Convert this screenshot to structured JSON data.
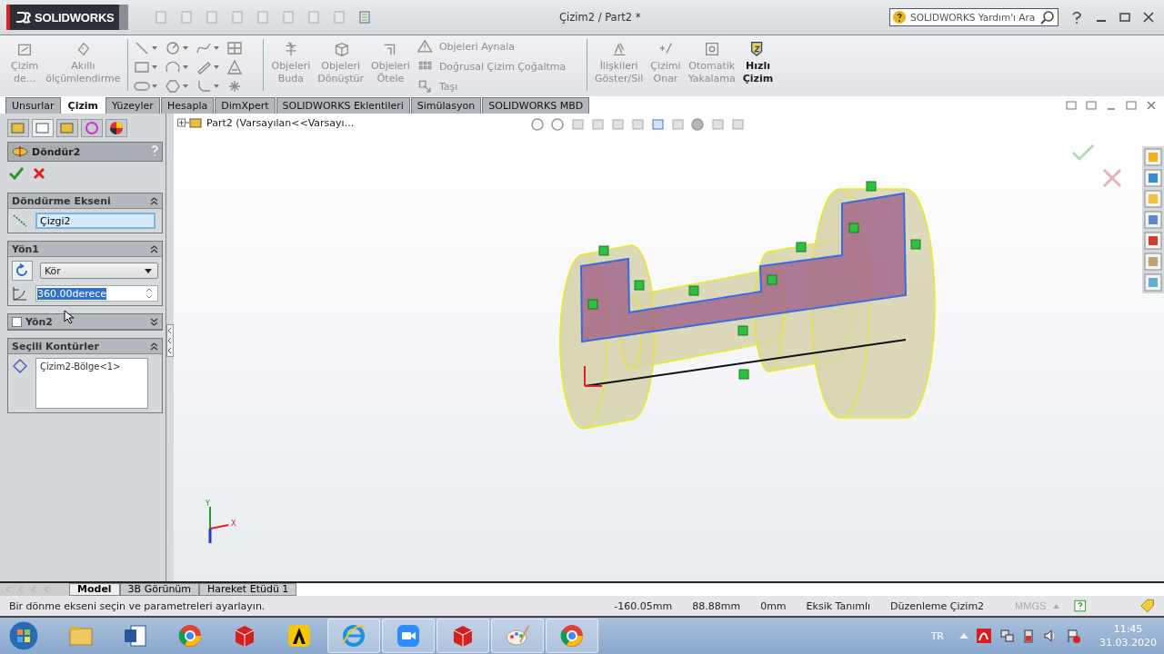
{
  "app": {
    "logo_text": "SOLIDWORKS",
    "title": "Çizim2 / Part2 *",
    "search_placeholder": "SOLIDWORKS Yardım'ı Ara"
  },
  "ribbon": {
    "left": [
      {
        "label": "Çizim de...",
        "kind": "sketch",
        "disabled": true
      },
      {
        "label": "Akıllı ölçümlendirme",
        "kind": "dimension",
        "disabled": true
      }
    ],
    "mid": [
      {
        "label": "Objeleri Buda",
        "kind": "trim",
        "disabled": true
      },
      {
        "label": "Objeleri Dönüştür",
        "kind": "convert",
        "disabled": true
      },
      {
        "label": "Objeleri Ötele",
        "kind": "offset",
        "disabled": true
      }
    ],
    "list": [
      {
        "label": "Objeleri Aynala",
        "kind": "mirror",
        "disabled": true
      },
      {
        "label": "Doğrusal Çizim Çoğaltma",
        "kind": "pattern",
        "disabled": true
      },
      {
        "label": "Taşı",
        "kind": "move",
        "disabled": true
      }
    ],
    "right": [
      {
        "label": "İlişkileri Göster/Sil",
        "kind": "relations",
        "disabled": true
      },
      {
        "label": "Çizimi Onar",
        "kind": "repair",
        "disabled": true
      },
      {
        "label": "Otomatik Yakalama",
        "kind": "snap",
        "disabled": true
      },
      {
        "label": "Hızlı Çizim",
        "kind": "rapid",
        "disabled": false
      }
    ]
  },
  "tabs": [
    {
      "label": "Unsurlar",
      "selected": false
    },
    {
      "label": "Çizim",
      "selected": true
    },
    {
      "label": "Yüzeyler",
      "selected": false
    },
    {
      "label": "Hesapla",
      "selected": false
    },
    {
      "label": "DimXpert",
      "selected": false
    },
    {
      "label": "SOLIDWORKS Eklentileri",
      "selected": false
    },
    {
      "label": "Simülasyon",
      "selected": false
    },
    {
      "label": "SOLIDWORKS MBD",
      "selected": false
    }
  ],
  "panel": {
    "title": "Döndür2",
    "axis": {
      "heading": "Döndürme Ekseni",
      "value": "Çizgi2"
    },
    "direction1": {
      "heading": "Yön1",
      "type": "Kör",
      "angle": "360.00derece"
    },
    "direction2": {
      "heading": "Yön2",
      "checked": false
    },
    "contours": {
      "heading": "Seçili Kontürler",
      "items": [
        "Çizim2-Bölge<1>"
      ]
    }
  },
  "viewport": {
    "tree_item": "Part2  (Varsayılan<<Varsayı...",
    "triad": {
      "x": "X",
      "y": "Y"
    }
  },
  "bottom_tabs": [
    {
      "label": "Model",
      "selected": true
    },
    {
      "label": "3B Görünüm",
      "selected": false
    },
    {
      "label": "Hareket Etüdü 1",
      "selected": false
    }
  ],
  "status_bar": {
    "message": "Bir dönme ekseni seçin ve parametreleri ayarlayın.",
    "x": "-160.05mm",
    "y": "88.88mm",
    "z": "0mm",
    "state": "Eksik Tanımlı",
    "mode": "Düzenleme Çizim2",
    "units": "MMGS"
  },
  "taskbar": {
    "apps": [
      {
        "kind": "folder",
        "running": false
      },
      {
        "kind": "word",
        "running": false
      },
      {
        "kind": "chrome",
        "running": false
      },
      {
        "kind": "cad",
        "running": false
      },
      {
        "kind": "chevron",
        "running": false
      },
      {
        "kind": "ie",
        "running": true
      },
      {
        "kind": "zoom",
        "running": true
      },
      {
        "kind": "cad",
        "running": true
      },
      {
        "kind": "paint",
        "running": true
      },
      {
        "kind": "chrome",
        "running": true
      }
    ],
    "language": "TR",
    "time": "11:45",
    "date": "31.03.2020"
  }
}
